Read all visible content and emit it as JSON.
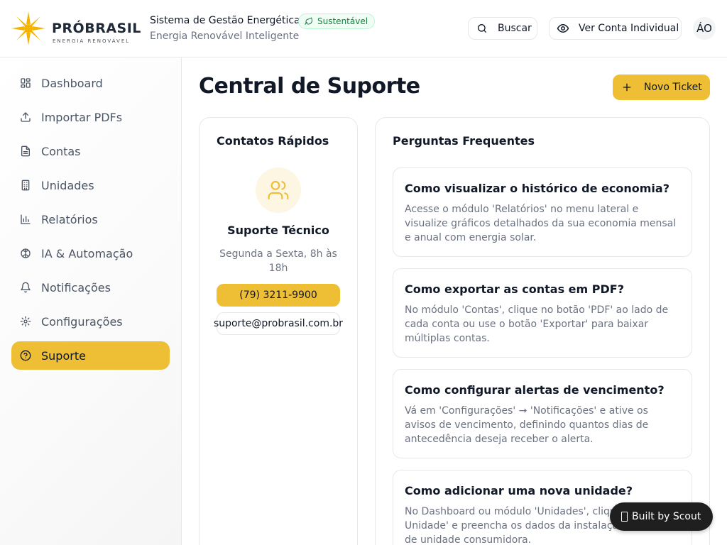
{
  "brand": {
    "name": "PRÓBRASIL",
    "tagline": "ENERGIA RENOVÁVEL",
    "accent": "#eebe35"
  },
  "header": {
    "title": "Sistema de Gestão Energética",
    "subtitle": "Energia Renovável Inteligente",
    "badge": "Sustentável",
    "search_label": "Buscar",
    "account_label": "Ver Conta Individual",
    "avatar_initials": "ÁO"
  },
  "sidebar": {
    "items": [
      {
        "label": "Dashboard",
        "icon": "grid-icon"
      },
      {
        "label": "Importar PDFs",
        "icon": "upload-icon"
      },
      {
        "label": "Contas",
        "icon": "file-text-icon"
      },
      {
        "label": "Unidades",
        "icon": "building-icon"
      },
      {
        "label": "Relatórios",
        "icon": "bar-chart-icon"
      },
      {
        "label": "IA & Automação",
        "icon": "brain-icon"
      },
      {
        "label": "Notificações",
        "icon": "bell-icon"
      },
      {
        "label": "Configurações",
        "icon": "gear-icon"
      },
      {
        "label": "Suporte",
        "icon": "help-circle-icon",
        "active": true
      }
    ]
  },
  "main": {
    "title": "Central de Suporte",
    "new_ticket_label": "Novo Ticket",
    "contacts": {
      "title": "Contatos Rápidos",
      "support_name": "Suporte Técnico",
      "hours": "Segunda a Sexta, 8h às 18h",
      "phone": "(79) 3211-9900",
      "email": "suporte@probrasil.com.br"
    },
    "faq": {
      "title": "Perguntas Frequentes",
      "items": [
        {
          "q": "Como visualizar o histórico de economia?",
          "a": "Acesse o módulo 'Relatórios' no menu lateral e visualize gráficos detalhados da sua economia mensal e anual com energia solar."
        },
        {
          "q": "Como exportar as contas em PDF?",
          "a": "No módulo 'Contas', clique no botão 'PDF' ao lado de cada conta ou use o botão 'Exportar' para baixar múltiplas contas."
        },
        {
          "q": "Como configurar alertas de vencimento?",
          "a": "Vá em 'Configurações' → 'Notificações' e ative os avisos de vencimento, definindo quantos dias de antecedência deseja receber o alerta."
        },
        {
          "q": "Como adicionar uma nova unidade?",
          "a": "No Dashboard ou módulo 'Unidades', clique em 'Nova Unidade' e preencha os dados da instalação e número de unidade consumidora."
        }
      ]
    }
  },
  "scout_badge": "Built by Scout"
}
